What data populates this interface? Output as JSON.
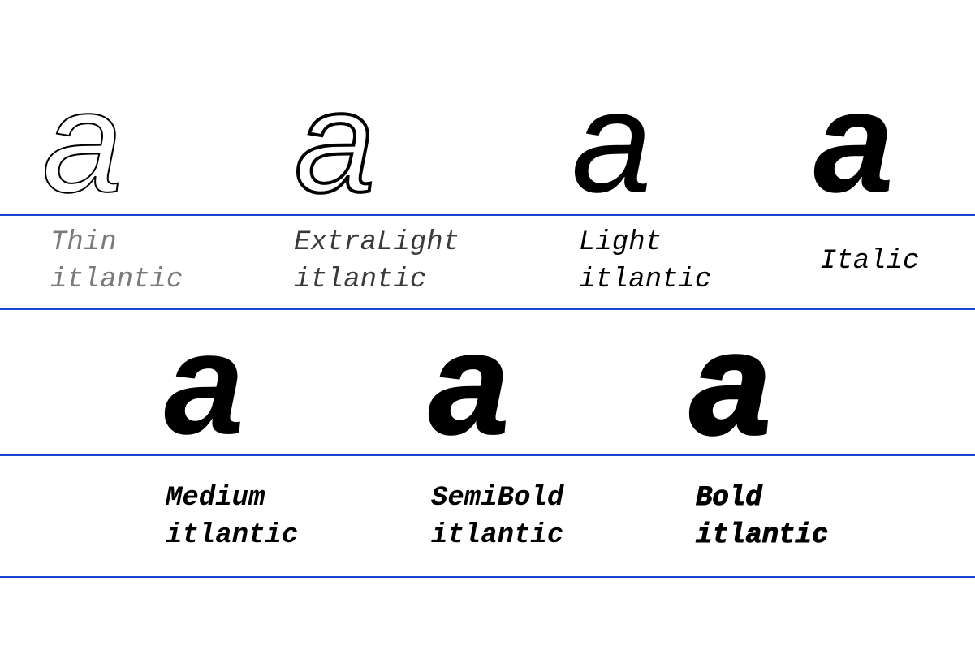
{
  "specimen": {
    "glyph_char": "a",
    "accent_color": "#1a46d6",
    "weights": [
      {
        "name": "Thin",
        "sample": "itlantic"
      },
      {
        "name": "ExtraLight",
        "sample": "itlantic"
      },
      {
        "name": "Light",
        "sample": "itlantic"
      },
      {
        "name": "Italic"
      },
      {
        "name": "Medium",
        "sample": "itlantic"
      },
      {
        "name": "SemiBold",
        "sample": "itlantic"
      },
      {
        "name": "Bold",
        "sample": "itlantic"
      }
    ]
  }
}
